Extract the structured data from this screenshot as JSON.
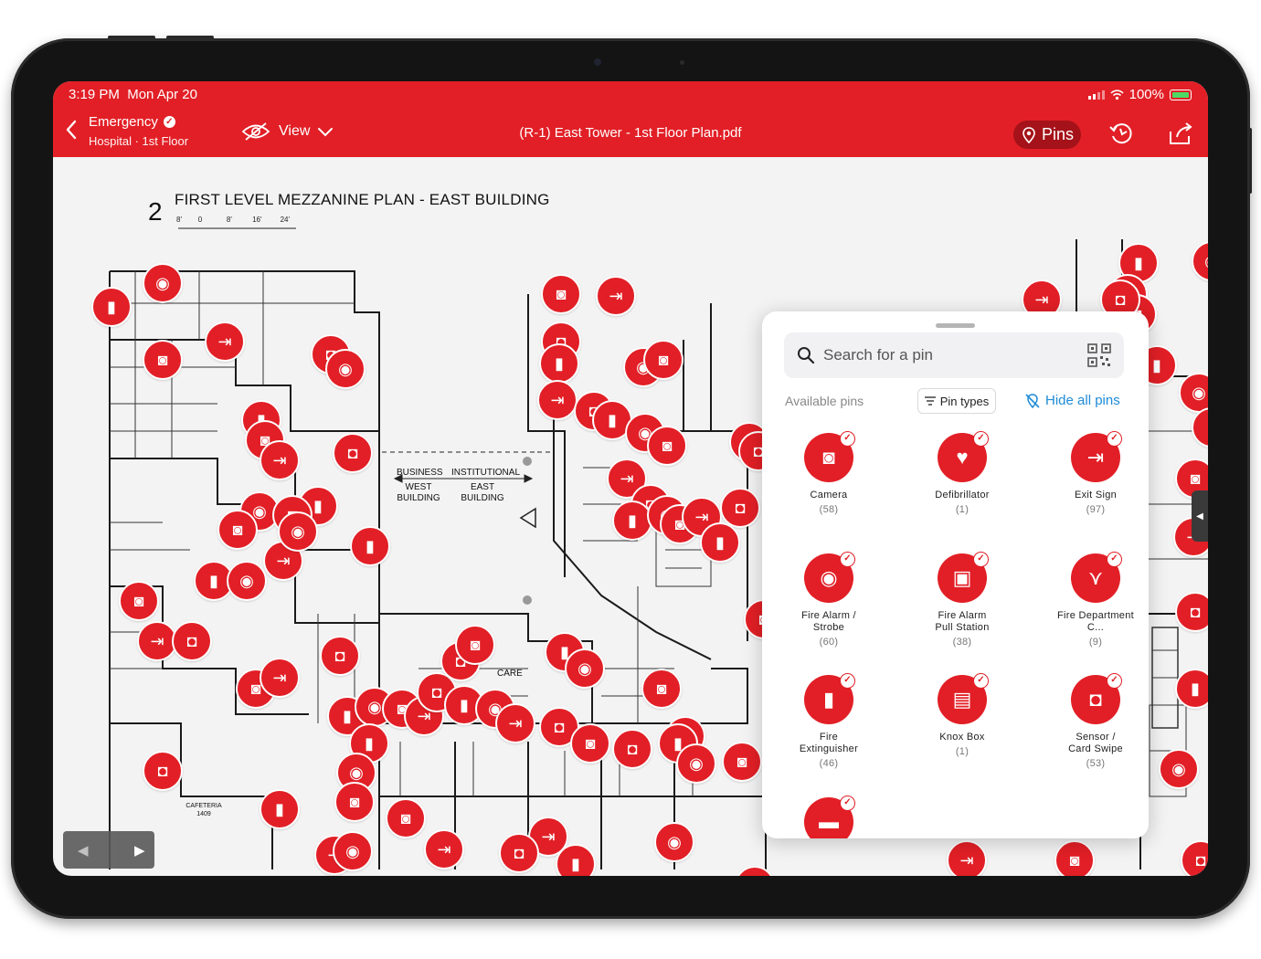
{
  "status_bar": {
    "time": "3:19 PM",
    "date": "Mon Apr 20",
    "battery": "100%"
  },
  "nav": {
    "context_title": "Emergency",
    "context_subtitle": "Hospital · 1st Floor",
    "view_label": "View",
    "document_title": "(R-1) East Tower - 1st Floor Plan.pdf",
    "pins_label": "Pins"
  },
  "plan": {
    "sheet_number": "2",
    "title": "FIRST LEVEL MEZZANINE PLAN - EAST BUILDING",
    "scale_ticks": [
      "8'",
      "0",
      "8'",
      "16'",
      "24'"
    ],
    "labels": {
      "business": "BUSINESS",
      "institutional": "INSTITUTIONAL",
      "west_building": "WEST BUILDING",
      "east_building": "EAST BUILDING",
      "care": "CARE",
      "cafeteria": "CAFETERIA 1409"
    }
  },
  "pins_panel": {
    "search_placeholder": "Search for a pin",
    "available_label": "Available pins",
    "pin_types_label": "Pin types",
    "hide_all_label": "Hide all pins",
    "types": [
      {
        "name": "Camera",
        "count": "(58)",
        "icon": "camera-icon"
      },
      {
        "name": "Defibrillator",
        "count": "(1)",
        "icon": "defibrillator-icon"
      },
      {
        "name": "Exit Sign",
        "count": "(97)",
        "icon": "exit-sign-icon"
      },
      {
        "name": "Fire Alarm / Strobe",
        "count": "(60)",
        "icon": "fire-alarm-icon"
      },
      {
        "name": "Fire Alarm Pull Station",
        "count": "(38)",
        "icon": "pull-station-icon"
      },
      {
        "name": "Fire Department C...",
        "count": "(9)",
        "icon": "fire-dept-connection-icon"
      },
      {
        "name": "Fire Extinguisher",
        "count": "(46)",
        "icon": "fire-extinguisher-icon"
      },
      {
        "name": "Knox Box",
        "count": "(1)",
        "icon": "knox-box-icon"
      },
      {
        "name": "Sensor / Card Swipe",
        "count": "(53)",
        "icon": "sensor-icon"
      }
    ]
  },
  "colors": {
    "brand_red": "#e21f26",
    "dark_red": "#a51219",
    "link_blue": "#1e8bd6"
  }
}
